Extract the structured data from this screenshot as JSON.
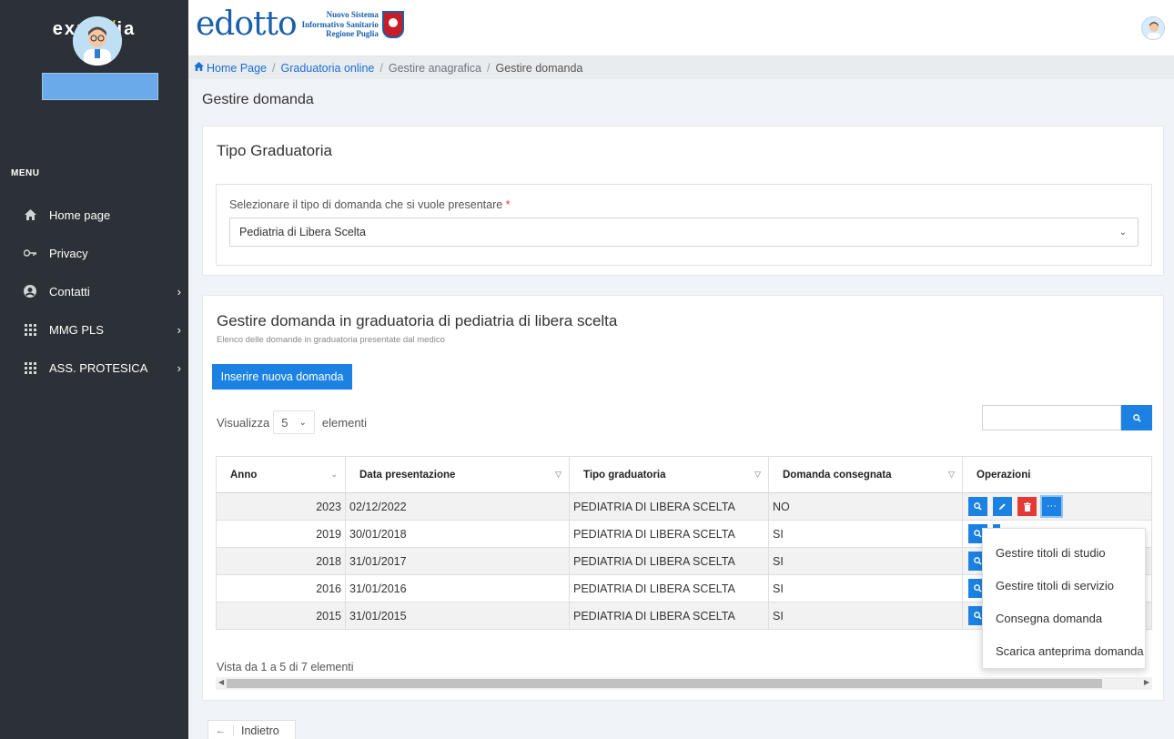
{
  "sidebar": {
    "brand_main": "expri",
    "brand_accent": "√",
    "brand_end": "ia",
    "menu_title": "MENU",
    "items": [
      {
        "label": "Home page",
        "icon": "home-icon",
        "has_chevron": false
      },
      {
        "label": "Privacy",
        "icon": "key-icon",
        "has_chevron": false
      },
      {
        "label": "Contatti",
        "icon": "user-circle-icon",
        "has_chevron": true
      },
      {
        "label": "MMG PLS",
        "icon": "grid-icon",
        "has_chevron": true
      },
      {
        "label": "ASS. PROTESICA",
        "icon": "grid-icon",
        "has_chevron": true
      }
    ]
  },
  "topbar": {
    "logo_text": "edotto",
    "logo_line1": "Nuovo Sistema",
    "logo_line2": "Informativo Sanitario",
    "logo_line3": "Regione Puglia"
  },
  "breadcrumb": {
    "home": "Home Page",
    "item2": "Graduatoria online",
    "item3": "Gestire anagrafica",
    "current": "Gestire domanda"
  },
  "page": {
    "title": "Gestire domanda"
  },
  "tipo_card": {
    "title": "Tipo Graduatoria",
    "field_label": "Selezionare il tipo di domanda che si vuole presentare",
    "required_mark": "*",
    "selected_value": "Pediatria di Libera Scelta"
  },
  "list_card": {
    "title": "Gestire domanda in graduatoria di pediatria di libera scelta",
    "subtitle": "Elenco delle domande in graduatoria presentate dal medico",
    "new_button": "Inserire nuova domanda",
    "show_label": "Visualizza",
    "page_size": "5",
    "show_suffix": "elementi",
    "columns": [
      "Anno",
      "Data presentazione",
      "Tipo graduatoria",
      "Domanda consegnata",
      "Operazioni"
    ],
    "rows": [
      {
        "anno": "2023",
        "data": "02/12/2022",
        "tipo": "PEDIATRIA DI LIBERA SCELTA",
        "consegnata": "NO"
      },
      {
        "anno": "2019",
        "data": "30/01/2018",
        "tipo": "PEDIATRIA DI LIBERA SCELTA",
        "consegnata": "SI"
      },
      {
        "anno": "2018",
        "data": "31/01/2017",
        "tipo": "PEDIATRIA DI LIBERA SCELTA",
        "consegnata": "SI"
      },
      {
        "anno": "2016",
        "data": "31/01/2016",
        "tipo": "PEDIATRIA DI LIBERA SCELTA",
        "consegnata": "SI"
      },
      {
        "anno": "2015",
        "data": "31/01/2015",
        "tipo": "PEDIATRIA DI LIBERA SCELTA",
        "consegnata": "SI"
      }
    ],
    "footer_info": "Vista da 1 a 5 di 7 elementi"
  },
  "dropdown": {
    "items": [
      "Gestire titoli di studio",
      "Gestire titoli di servizio",
      "Consegna domanda",
      "Scarica anteprima domanda"
    ]
  },
  "back_button": "Indietro",
  "colors": {
    "sidebar_bg": "#2b3136",
    "primary": "#1b82e3",
    "danger": "#e53935",
    "link": "#1b6ed4"
  }
}
